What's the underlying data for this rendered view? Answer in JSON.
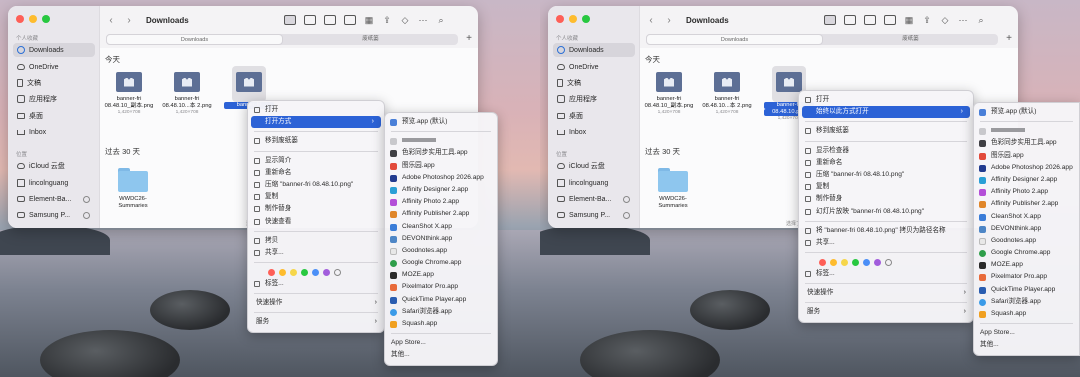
{
  "window": {
    "title": "Downloads",
    "tabs": [
      "Downloads",
      "废纸篓"
    ]
  },
  "sidebar": {
    "sections": {
      "favorites": "个人收藏",
      "locations": "位置"
    },
    "favorites": [
      {
        "label": "Downloads",
        "icon": "download-icon"
      },
      {
        "label": "OneDrive",
        "icon": "cloud-icon"
      },
      {
        "label": "文稿",
        "icon": "document-icon"
      },
      {
        "label": "应用程序",
        "icon": "applications-icon"
      },
      {
        "label": "桌面",
        "icon": "desktop-icon"
      },
      {
        "label": "Inbox",
        "icon": "inbox-icon"
      }
    ],
    "locations": [
      {
        "label": "iCloud 云盘",
        "icon": "cloud-icon"
      },
      {
        "label": "lincolnguang",
        "icon": "home-icon"
      },
      {
        "label": "Element-Ba...",
        "icon": "disk-icon"
      },
      {
        "label": "Samsung P...",
        "icon": "disk-icon"
      }
    ]
  },
  "content": {
    "group_today": "今天",
    "group_30days": "过去 30 天",
    "files": [
      {
        "name1": "banner-fri",
        "name2": "08.48.10_副本.png",
        "dim": "1,420×708"
      },
      {
        "name1": "banner-fri",
        "name2": "08.48.10...本 2.png",
        "dim": "1,420×708"
      },
      {
        "name1": "banner-fri",
        "name2": "08.48.10.png",
        "dim": "1,420×708"
      }
    ],
    "folder": {
      "name1": "WWDC26-",
      "name2": "Summaries"
    },
    "status_partial": "选择了"
  },
  "left_menu": {
    "items": [
      "打开",
      "打开方式",
      "移到废纸篓",
      "显示简介",
      "重新命名",
      "压缩 \"banner-fri 08.48.10.png\"",
      "复制",
      "制作替身",
      "快速查看",
      "拷贝",
      "共享...",
      "标签...",
      "快速操作",
      "服务"
    ]
  },
  "right_menu": {
    "items": [
      "打开",
      "始终以此方式打开",
      "移到废纸篓",
      "显示检查器",
      "重新命名",
      "压缩 \"banner-fri 08.48.10.png\"",
      "复制",
      "制作替身",
      "幻灯片放映 \"banner-fri 08.48.10.png\"",
      "将 \"banner-fri 08.48.10.png\" 拷贝为路径名称",
      "共享...",
      "标签...",
      "快速操作",
      "服务"
    ]
  },
  "apps_menu": {
    "default_app": "预览.app (默认)",
    "apps": [
      "色彩同步实用工具.app",
      "图乐园.app",
      "Adobe Photoshop 2026.app",
      "Affinity Designer 2.app",
      "Affinity Photo 2.app",
      "Affinity Publisher 2.app",
      "CleanShot X.app",
      "DEVONthink.app",
      "Goodnotes.app",
      "Google Chrome.app",
      "MOZE.app",
      "Pixelmator Pro.app",
      "QuickTime Player.app",
      "Safari浏览器.app",
      "Squash.app"
    ],
    "footer": [
      "App Store...",
      "其他..."
    ]
  },
  "tag_colors": [
    "#fe5f57",
    "#febc2e",
    "#f6d64a",
    "#28c840",
    "#4b8ff7",
    "#a25ddc",
    "#9a9a9e"
  ],
  "app_icon_colors": [
    "#3f3f44",
    "#e24a3b",
    "#223b8f",
    "#2a9fd6",
    "#b44fd8",
    "#e0862a",
    "#3b7dd8",
    "#4e86c6",
    "#e8e8e8",
    "#2f9e4a",
    "#2a2a2a",
    "#e86a3a",
    "#2a5db0",
    "#3b9be8",
    "#f0a020"
  ]
}
